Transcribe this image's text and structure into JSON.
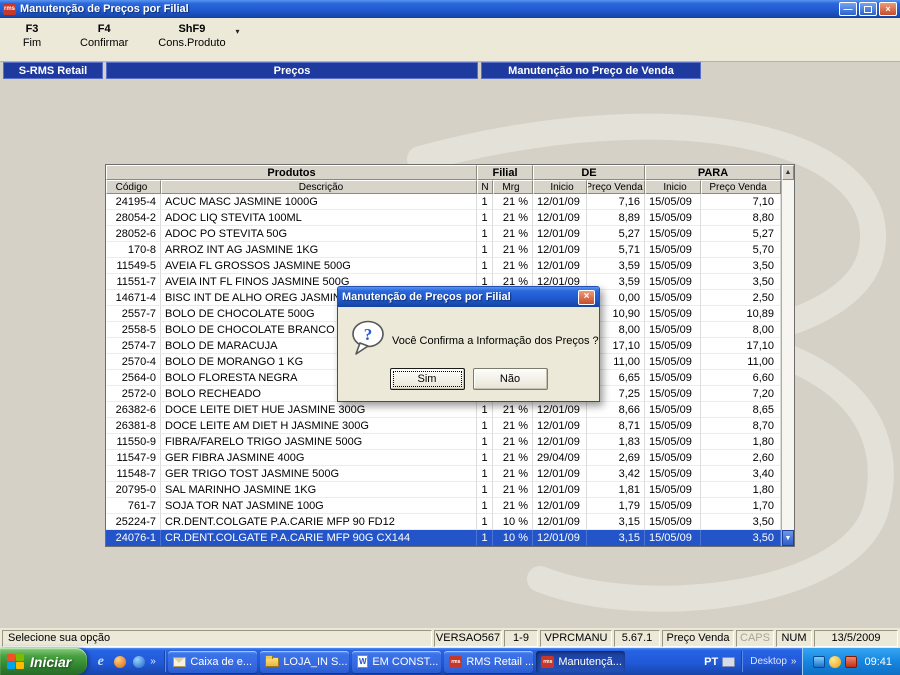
{
  "window": {
    "title": "Manutenção de Preços por Filial",
    "icon_label": "rms"
  },
  "colors": {
    "band_navy": "#1E3A9E",
    "selection_blue": "#2355C8",
    "titlebar_blue": "#2058CC",
    "taskbar_blue": "#2159D8",
    "start_green": "#2F7D2E"
  },
  "icons": {
    "minimize": "—",
    "close": "×",
    "dropdown": "▾",
    "scroll_up": "▲",
    "scroll_down": "▼",
    "chevron": "»",
    "question_mark": "?",
    "word": "W",
    "rms": "rms"
  },
  "toolbar": {
    "items": [
      {
        "key": "F3",
        "label": "Fim"
      },
      {
        "key": "F4",
        "label": "Confirmar"
      },
      {
        "key": "ShF9",
        "label": "Cons.Produto"
      }
    ]
  },
  "header_band": {
    "app": "S-RMS Retail",
    "module": "Preços",
    "screen": "Manutenção no Preço de Venda"
  },
  "table": {
    "group_headers": [
      "Produtos",
      "Filial",
      "DE",
      "PARA"
    ],
    "column_headers": [
      "Código",
      "Descrição",
      "N",
      "Mrg",
      "Inicio",
      "Preço Venda",
      "Inicio",
      "Preço Venda"
    ],
    "selected_row_index": 21,
    "rows": [
      {
        "codigo": "24195-4",
        "descricao": "ACUC MASC JASMINE 1000G",
        "n": "1",
        "mrg": "21 %",
        "de_inicio": "12/01/09",
        "de_preco": "7,16",
        "para_inicio": "15/05/09",
        "para_preco": "7,10"
      },
      {
        "codigo": "28054-2",
        "descricao": "ADOC LIQ STEVITA 100ML",
        "n": "1",
        "mrg": "21 %",
        "de_inicio": "12/01/09",
        "de_preco": "8,89",
        "para_inicio": "15/05/09",
        "para_preco": "8,80"
      },
      {
        "codigo": "28052-6",
        "descricao": "ADOC PO STEVITA 50G",
        "n": "1",
        "mrg": "21 %",
        "de_inicio": "12/01/09",
        "de_preco": "5,27",
        "para_inicio": "15/05/09",
        "para_preco": "5,27"
      },
      {
        "codigo": "170-8",
        "descricao": "ARROZ INT AG JASMINE 1KG",
        "n": "1",
        "mrg": "21 %",
        "de_inicio": "12/01/09",
        "de_preco": "5,71",
        "para_inicio": "15/05/09",
        "para_preco": "5,70"
      },
      {
        "codigo": "11549-5",
        "descricao": "AVEIA FL GROSSOS JASMINE 500G",
        "n": "1",
        "mrg": "21 %",
        "de_inicio": "12/01/09",
        "de_preco": "3,59",
        "para_inicio": "15/05/09",
        "para_preco": "3,50"
      },
      {
        "codigo": "11551-7",
        "descricao": "AVEIA INT FL FINOS JASMINE 500G",
        "n": "1",
        "mrg": "21 %",
        "de_inicio": "12/01/09",
        "de_preco": "3,59",
        "para_inicio": "15/05/09",
        "para_preco": "3,50"
      },
      {
        "codigo": "14671-4",
        "descricao": "BISC INT DE ALHO OREG JASMINE 200G",
        "n": "",
        "mrg": "",
        "de_inicio": "",
        "de_preco": "0,00",
        "para_inicio": "15/05/09",
        "para_preco": "2,50"
      },
      {
        "codigo": "2557-7",
        "descricao": "BOLO DE CHOCOLATE 500G",
        "n": "",
        "mrg": "",
        "de_inicio": "",
        "de_preco": "10,90",
        "para_inicio": "15/05/09",
        "para_preco": "10,89"
      },
      {
        "codigo": "2558-5",
        "descricao": "BOLO DE CHOCOLATE BRANCO 1 KG",
        "n": "",
        "mrg": "",
        "de_inicio": "",
        "de_preco": "8,00",
        "para_inicio": "15/05/09",
        "para_preco": "8,00"
      },
      {
        "codigo": "2574-7",
        "descricao": "BOLO DE MARACUJA",
        "n": "",
        "mrg": "",
        "de_inicio": "",
        "de_preco": "17,10",
        "para_inicio": "15/05/09",
        "para_preco": "17,10"
      },
      {
        "codigo": "2570-4",
        "descricao": "BOLO DE MORANGO 1 KG",
        "n": "",
        "mrg": "",
        "de_inicio": "",
        "de_preco": "11,00",
        "para_inicio": "15/05/09",
        "para_preco": "11,00"
      },
      {
        "codigo": "2564-0",
        "descricao": "BOLO FLORESTA NEGRA",
        "n": "",
        "mrg": "",
        "de_inicio": "",
        "de_preco": "6,65",
        "para_inicio": "15/05/09",
        "para_preco": "6,60"
      },
      {
        "codigo": "2572-0",
        "descricao": "BOLO RECHEADO",
        "n": "",
        "mrg": "",
        "de_inicio": "",
        "de_preco": "7,25",
        "para_inicio": "15/05/09",
        "para_preco": "7,20"
      },
      {
        "codigo": "26382-6",
        "descricao": "DOCE  LEITE DIET HUE JASMINE 300G",
        "n": "1",
        "mrg": "21 %",
        "de_inicio": "12/01/09",
        "de_preco": "8,66",
        "para_inicio": "15/05/09",
        "para_preco": "8,65"
      },
      {
        "codigo": "26381-8",
        "descricao": "DOCE LEITE AM DIET H JASMINE 300G",
        "n": "1",
        "mrg": "21 %",
        "de_inicio": "12/01/09",
        "de_preco": "8,71",
        "para_inicio": "15/05/09",
        "para_preco": "8,70"
      },
      {
        "codigo": "11550-9",
        "descricao": "FIBRA/FARELO TRIGO JASMINE 500G",
        "n": "1",
        "mrg": "21 %",
        "de_inicio": "12/01/09",
        "de_preco": "1,83",
        "para_inicio": "15/05/09",
        "para_preco": "1,80"
      },
      {
        "codigo": "11547-9",
        "descricao": "GER FIBRA JASMINE 400G",
        "n": "1",
        "mrg": "21 %",
        "de_inicio": "29/04/09",
        "de_preco": "2,69",
        "para_inicio": "15/05/09",
        "para_preco": "2,60"
      },
      {
        "codigo": "11548-7",
        "descricao": "GER TRIGO TOST JASMINE 500G",
        "n": "1",
        "mrg": "21 %",
        "de_inicio": "12/01/09",
        "de_preco": "3,42",
        "para_inicio": "15/05/09",
        "para_preco": "3,40"
      },
      {
        "codigo": "20795-0",
        "descricao": "SAL MARINHO JASMINE 1KG",
        "n": "1",
        "mrg": "21 %",
        "de_inicio": "12/01/09",
        "de_preco": "1,81",
        "para_inicio": "15/05/09",
        "para_preco": "1,80"
      },
      {
        "codigo": "761-7",
        "descricao": "SOJA TOR NAT JASMINE 100G",
        "n": "1",
        "mrg": "21 %",
        "de_inicio": "12/01/09",
        "de_preco": "1,79",
        "para_inicio": "15/05/09",
        "para_preco": "1,70"
      },
      {
        "codigo": "25224-7",
        "descricao": "CR.DENT.COLGATE P.A.CARIE MFP 90 FD12",
        "n": "1",
        "mrg": "10 %",
        "de_inicio": "12/01/09",
        "de_preco": "3,15",
        "para_inicio": "15/05/09",
        "para_preco": "3,50"
      },
      {
        "codigo": "24076-1",
        "descricao": "CR.DENT.COLGATE P.A.CARIE MFP 90G CX144",
        "n": "1",
        "mrg": "10 %",
        "de_inicio": "12/01/09",
        "de_preco": "3,15",
        "para_inicio": "15/05/09",
        "para_preco": "3,50"
      }
    ]
  },
  "dialog": {
    "title": "Manutenção de Preços por Filial",
    "message": "Você Confirma a Informação dos Preços ?",
    "buttons": [
      "Sim",
      "Não"
    ]
  },
  "statusbar": {
    "message": "Selecione sua opção",
    "fields": [
      "VERSAO567",
      "1-9",
      "VPRCMANU",
      "5.67.1",
      "Preço Venda",
      "CAPS",
      "NUM",
      "13/5/2009"
    ]
  },
  "taskbar": {
    "start_label": "Iniciar",
    "tasks": [
      {
        "label": "Caixa de e..."
      },
      {
        "label": "LOJA_IN S..."
      },
      {
        "label": "EM CONST..."
      },
      {
        "label": "RMS Retail ..."
      },
      {
        "label": "Manutençã..."
      }
    ],
    "tray": {
      "lang": "PT",
      "desktop_label": "Desktop",
      "clock": "09:41"
    }
  }
}
